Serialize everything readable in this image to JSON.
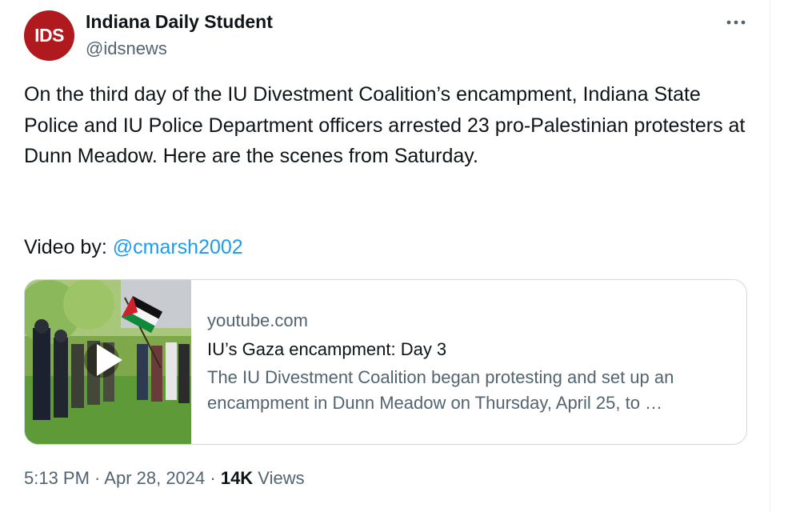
{
  "account": {
    "avatar_text": "IDS",
    "name": "Indiana Daily Student",
    "handle": "@idsnews"
  },
  "tweet": {
    "text": "On the third day of the IU Divestment Coalition’s encampment, Indiana State Police and IU Police Department officers arrested 23 pro-Palestinian protesters at Dunn Meadow. Here are the scenes from Saturday.",
    "video_by_label": "Video by: ",
    "video_by_mention": "@cmarsh2002"
  },
  "link_card": {
    "domain": "youtube.com",
    "title": "IU’s Gaza encampment: Day 3",
    "description": "The IU Divestment Coalition began protesting and set up an encampment in Dunn Meadow on Thursday, April 25, to …"
  },
  "meta": {
    "time": "5:13 PM",
    "separator": " · ",
    "date": "Apr 28, 2024",
    "views_count": "14K",
    "views_label": " Views"
  },
  "icons": {
    "more": "more-horizontal-icon",
    "play": "play-icon"
  },
  "colors": {
    "link": "#1d9bf0",
    "secondary_text": "#536471",
    "avatar_bg": "#b0191e"
  }
}
